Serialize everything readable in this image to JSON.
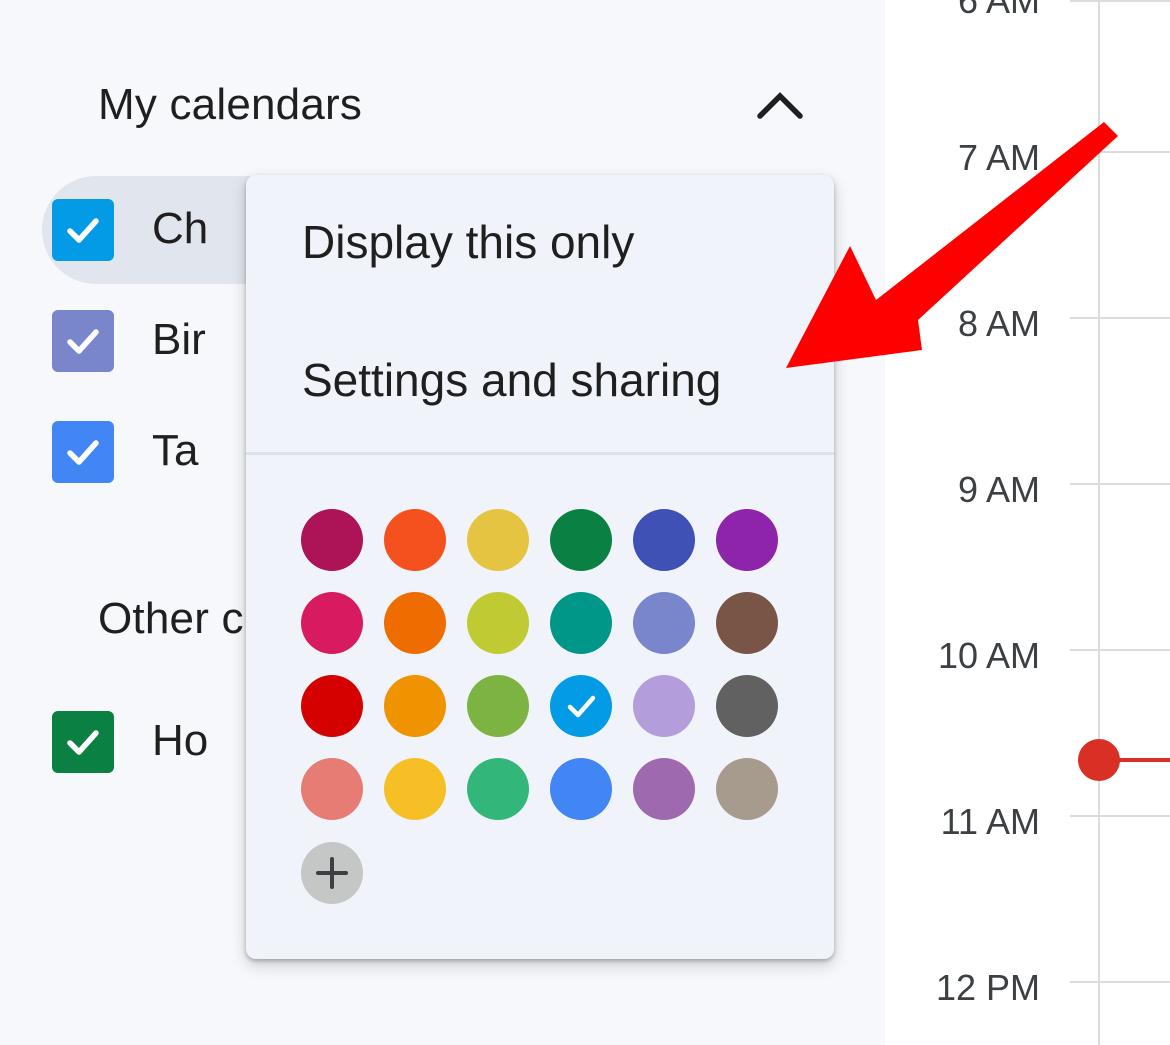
{
  "my_calendars": {
    "title": "My calendars",
    "items": [
      {
        "label": "Ch",
        "color": "#039be5",
        "checked": true
      },
      {
        "label": "Bir",
        "color": "#7986cb",
        "checked": true
      },
      {
        "label": "Ta",
        "color": "#4285f4",
        "checked": true
      }
    ]
  },
  "other_calendars": {
    "title": "Other c",
    "items": [
      {
        "label": "Ho",
        "color": "#0b8043",
        "checked": true
      }
    ]
  },
  "context_menu": {
    "display_only": "Display this only",
    "settings_sharing": "Settings and sharing",
    "selected_color": "#039be5",
    "colors": [
      [
        "#ad1457",
        "#f4511e",
        "#e4c441",
        "#0b8043",
        "#3f51b5",
        "#8e24aa"
      ],
      [
        "#d81b60",
        "#ef6c00",
        "#c0ca33",
        "#009688",
        "#7986cb",
        "#795548"
      ],
      [
        "#d50000",
        "#f09300",
        "#7cb342",
        "#039be5",
        "#b39ddb",
        "#616161"
      ],
      [
        "#e67c73",
        "#f6bf26",
        "#33b679",
        "#4285f4",
        "#9e69af",
        "#a79b8e"
      ]
    ]
  },
  "timeline": {
    "top_partial": "6 AM",
    "hours": [
      "7 AM",
      "8 AM",
      "9 AM",
      "10 AM",
      "11 AM",
      "12 PM"
    ],
    "now_color": "#d93025"
  },
  "annotation": {
    "arrow_color": "#ff0000"
  }
}
